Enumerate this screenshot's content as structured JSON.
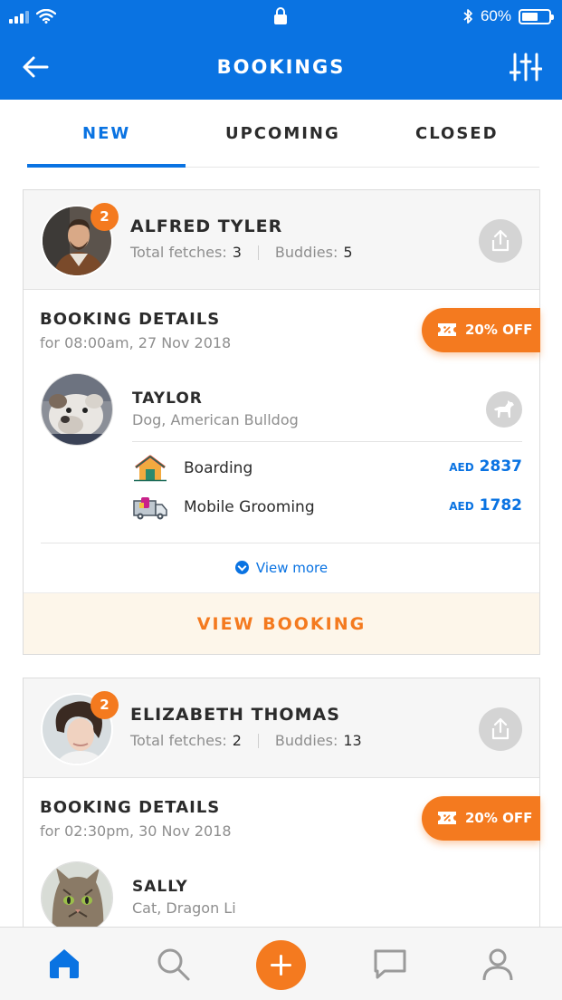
{
  "status_bar": {
    "battery": "60%",
    "battery_level": 0.6
  },
  "header": {
    "title": "BOOKINGS"
  },
  "tabs": [
    {
      "label": "NEW",
      "active": true
    },
    {
      "label": "UPCOMING",
      "active": false
    },
    {
      "label": "CLOSED",
      "active": false
    }
  ],
  "bookings": [
    {
      "owner": {
        "name": "ALFRED TYLER",
        "badge": "2",
        "fetches_label": "Total fetches:",
        "fetches": "3",
        "buddies_label": "Buddies:",
        "buddies": "5"
      },
      "details_title": "BOOKING DETAILS",
      "date": "for 08:00am, 27 Nov 2018",
      "discount": "20% OFF",
      "pet": {
        "name": "TAYLOR",
        "breed": "Dog, American Bulldog",
        "type_icon": "dog-icon"
      },
      "services": [
        {
          "name": "Boarding",
          "currency": "AED",
          "price": "2837",
          "icon": "house-icon"
        },
        {
          "name": "Mobile Grooming",
          "currency": "AED",
          "price": "1782",
          "icon": "grooming-van-icon"
        }
      ],
      "view_more": "View more",
      "view_booking": "VIEW BOOKING"
    },
    {
      "owner": {
        "name": "ELIZABETH THOMAS",
        "badge": "2",
        "fetches_label": "Total fetches:",
        "fetches": "2",
        "buddies_label": "Buddies:",
        "buddies": "13"
      },
      "details_title": "BOOKING DETAILS",
      "date": "for 02:30pm, 30 Nov 2018",
      "discount": "20% OFF",
      "pet": {
        "name": "SALLY",
        "breed": "Cat, Dragon Li"
      }
    }
  ],
  "tab_bar": {
    "items": [
      "home-icon",
      "search-icon",
      "add-icon",
      "chat-icon",
      "profile-icon"
    ],
    "active": "home-icon"
  },
  "colors": {
    "primary": "#0a73e2",
    "accent": "#f47a1f"
  }
}
